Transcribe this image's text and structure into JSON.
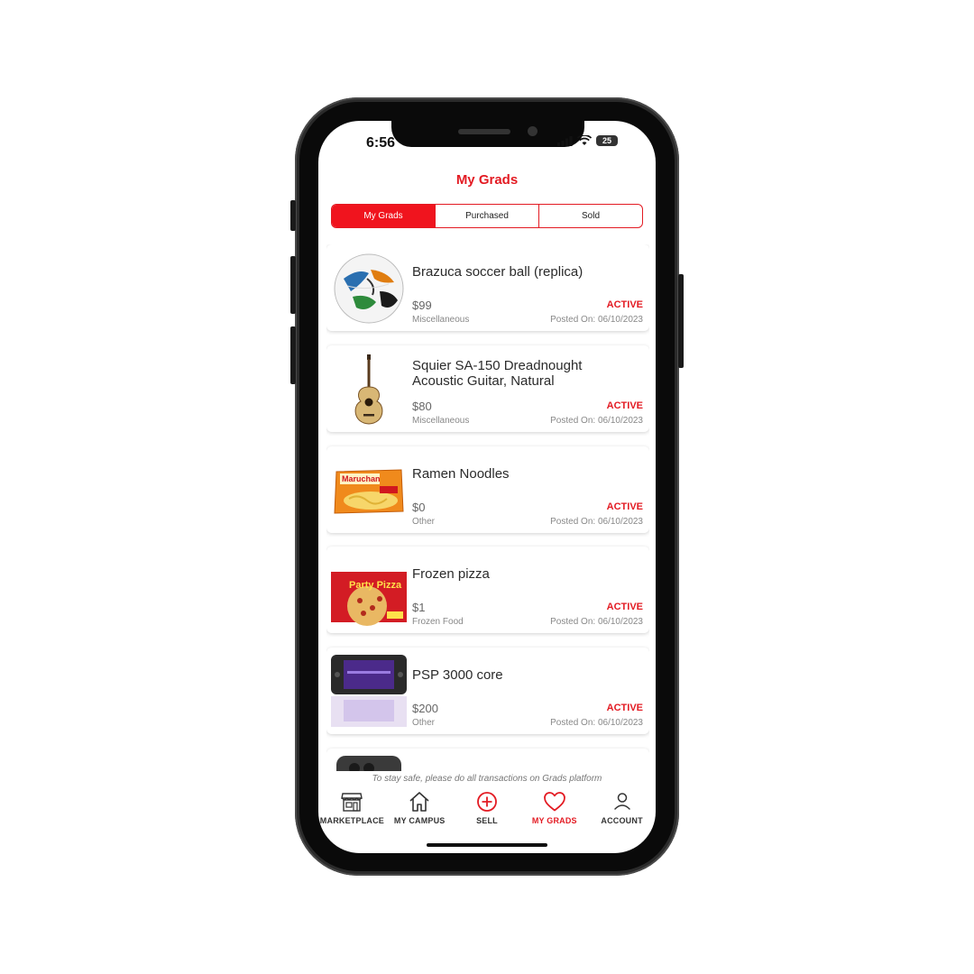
{
  "status_bar": {
    "time": "6:56",
    "battery": "25"
  },
  "header": {
    "title": "My Grads"
  },
  "segments": [
    {
      "label": "My Grads",
      "active": true
    },
    {
      "label": "Purchased",
      "active": false
    },
    {
      "label": "Sold",
      "active": false
    }
  ],
  "listings": [
    {
      "name": "Brazuca soccer ball (replica)",
      "price": "$99",
      "category": "Miscellaneous",
      "status": "ACTIVE",
      "posted": "Posted On: 06/10/2023",
      "image": "soccer-ball"
    },
    {
      "name": "Squier SA-150 Dreadnought Acoustic Guitar, Natural",
      "price": "$80",
      "category": "Miscellaneous",
      "status": "ACTIVE",
      "posted": "Posted On: 06/10/2023",
      "image": "acoustic-guitar"
    },
    {
      "name": "Ramen Noodles",
      "price": "$0",
      "category": "Other",
      "status": "ACTIVE",
      "posted": "Posted On: 06/10/2023",
      "image": "ramen-noodles-pack",
      "image_text": "Maruchan"
    },
    {
      "name": "Frozen pizza",
      "price": "$1",
      "category": "Frozen Food",
      "status": "ACTIVE",
      "posted": "Posted On: 06/10/2023",
      "image": "frozen-pizza-box",
      "image_text": "Party Pizza"
    },
    {
      "name": "PSP 3000 core",
      "price": "$200",
      "category": "Other",
      "status": "ACTIVE",
      "posted": "Posted On: 06/10/2023",
      "image": "psp-console"
    }
  ],
  "footer_notice": "To stay safe, please do all transactions on Grads platform",
  "tabs": [
    {
      "label": "MARKETPLACE",
      "icon": "storefront-icon"
    },
    {
      "label": "MY CAMPUS",
      "icon": "home-icon"
    },
    {
      "label": "SELL",
      "icon": "plus-circle-icon"
    },
    {
      "label": "MY GRADS",
      "icon": "heart-icon"
    },
    {
      "label": "ACCOUNT",
      "icon": "person-icon"
    }
  ],
  "colors": {
    "accent": "#e31b23",
    "text": "#2b2b2b",
    "muted": "#888888"
  }
}
